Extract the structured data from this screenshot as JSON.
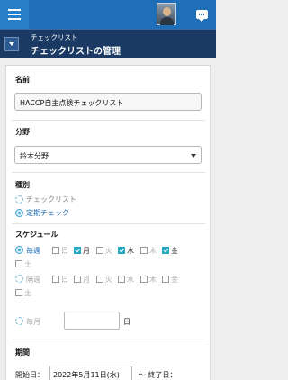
{
  "header": {
    "breadcrumb": "チェックリスト",
    "title": "チェックリストの管理"
  },
  "form": {
    "name_label": "名前",
    "name_value": "HACCP自主点検チェックリスト",
    "category_label": "分野",
    "category_value": "鈴木分野",
    "type_label": "種別",
    "type_options": [
      {
        "label": "チェックリスト",
        "selected": false
      },
      {
        "label": "定期チェック",
        "selected": true
      }
    ],
    "schedule_label": "スケジュール",
    "schedule_rows": [
      {
        "label": "毎週",
        "selected": true
      },
      {
        "label": "隔週",
        "selected": false
      },
      {
        "label": "毎月",
        "selected": false
      }
    ],
    "days": [
      "日",
      "月",
      "火",
      "水",
      "木",
      "金",
      "土"
    ],
    "weekly_checked": [
      false,
      true,
      false,
      true,
      false,
      true,
      false
    ],
    "biweekly_checked": [
      false,
      false,
      false,
      false,
      false,
      false,
      false
    ],
    "month_suffix": "日",
    "period_label": "期間",
    "start_label": "開始日：",
    "start_value": "2022年5月11日(水)",
    "end_label": "～ 終了日："
  }
}
